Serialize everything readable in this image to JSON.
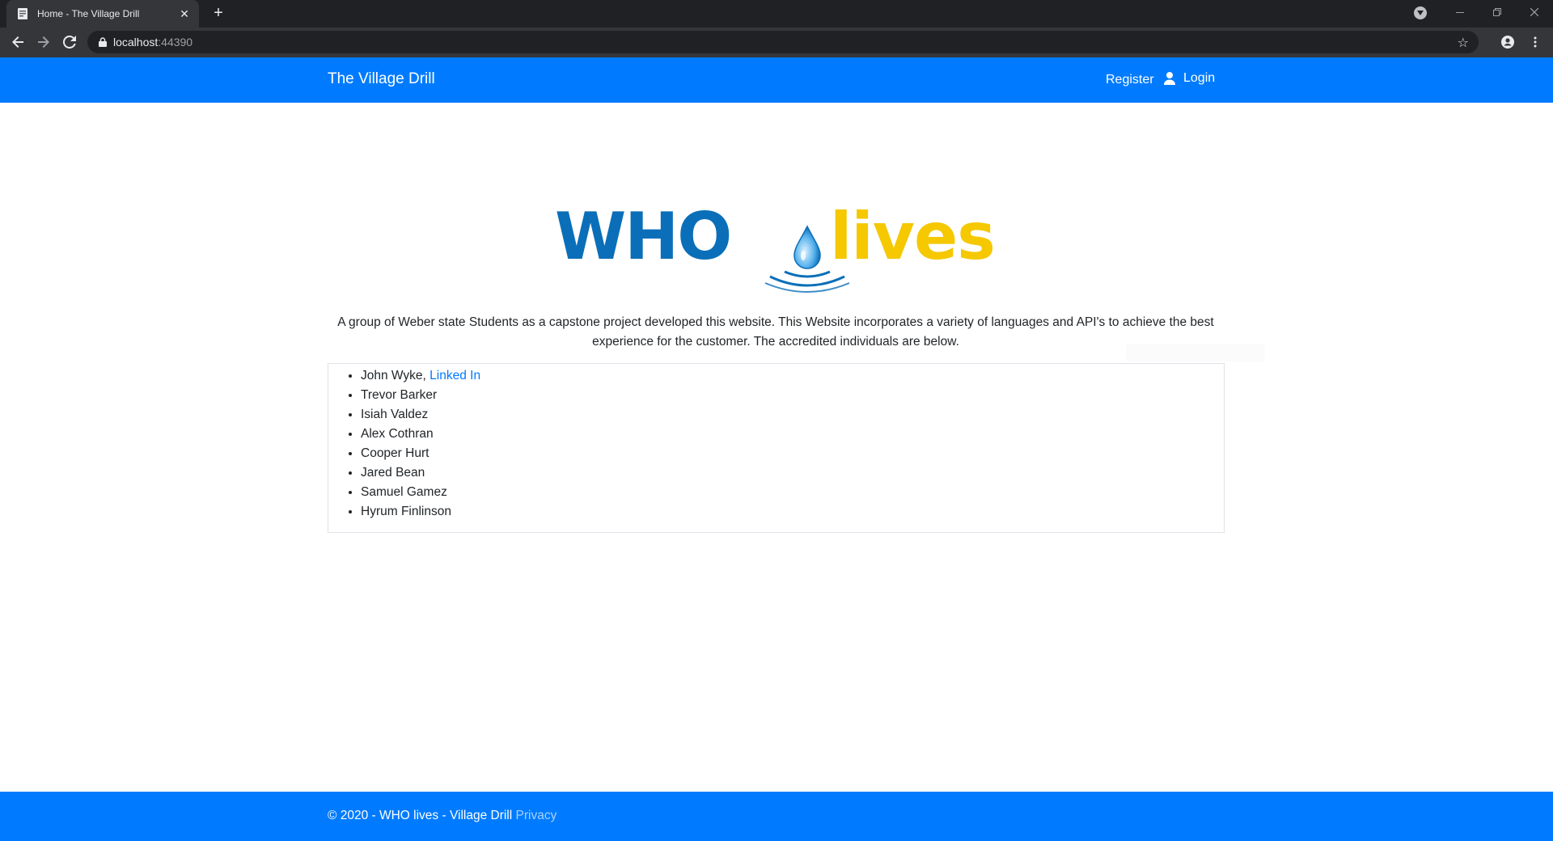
{
  "browser": {
    "tab_title": "Home - The Village Drill",
    "tab_close": "✕",
    "new_tab": "+",
    "url_host": "localhost",
    "url_port": ":44390"
  },
  "site": {
    "brand": "The Village Drill",
    "nav": {
      "register": "Register",
      "login": "Login"
    },
    "logo": {
      "who": "WHO",
      "lives": "lives"
    },
    "intro": "A group of Weber state Students as a capstone project developed this website. This Website incorporates a variety of languages and API's to achieve the best experience for the customer. The accredited individuals are below.",
    "team": [
      {
        "name": "John Wyke,",
        "link": "Linked In"
      },
      {
        "name": "Trevor Barker"
      },
      {
        "name": "Isiah Valdez"
      },
      {
        "name": "Alex Cothran"
      },
      {
        "name": "Cooper Hurt"
      },
      {
        "name": "Jared Bean"
      },
      {
        "name": "Samuel Gamez"
      },
      {
        "name": "Hyrum Finlinson"
      }
    ],
    "footer": {
      "text": "© 2020 - WHO lives - Village Drill",
      "privacy": "Privacy"
    }
  },
  "colors": {
    "nav_blue": "#007bff",
    "logo_blue": "#0a6fb8",
    "logo_yellow": "#f5c800"
  }
}
